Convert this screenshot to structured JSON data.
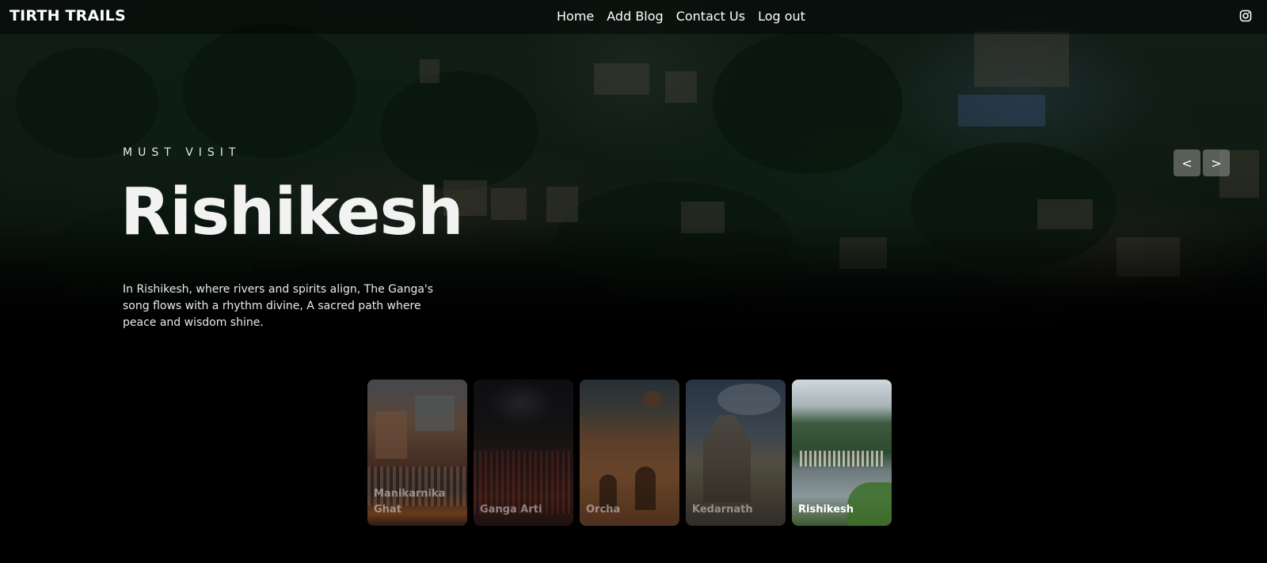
{
  "brand": "TIRTH TRAILS",
  "nav": {
    "links": [
      "Home",
      "Add Blog",
      "Contact Us",
      "Log out"
    ]
  },
  "social": {
    "icon": "instagram-icon"
  },
  "hero": {
    "eyebrow": "MUST VISIT",
    "title": "Rishikesh",
    "description": "In Rishikesh, where rivers and spirits align, The Ganga's song flows with a rhythm divine, A sacred path where peace and wisdom shine."
  },
  "controls": {
    "prev": "<",
    "next": ">"
  },
  "thumbnails": [
    {
      "label_line1": "Manikarnika",
      "label_line2": "Ghat",
      "active": false
    },
    {
      "label_line1": "",
      "label_line2": "Ganga Arti",
      "active": false
    },
    {
      "label_line1": "",
      "label_line2": "Orcha",
      "active": false
    },
    {
      "label_line1": "",
      "label_line2": "Kedarnath",
      "active": false
    },
    {
      "label_line1": "",
      "label_line2": "Rishikesh",
      "active": true
    }
  ]
}
